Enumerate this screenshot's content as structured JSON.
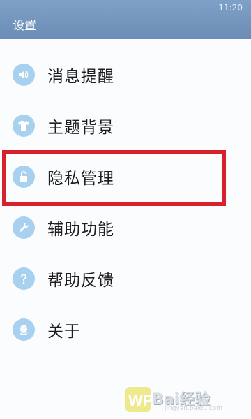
{
  "status_bar": {
    "time": "11:20"
  },
  "header": {
    "title": "设置"
  },
  "settings": {
    "items": [
      {
        "label": "消息提醒",
        "icon": "speaker-icon"
      },
      {
        "label": "主题背景",
        "icon": "tshirt-icon"
      },
      {
        "label": "隐私管理",
        "icon": "lock-icon"
      },
      {
        "label": "辅助功能",
        "icon": "wrench-icon"
      },
      {
        "label": "帮助反馈",
        "icon": "question-icon"
      },
      {
        "label": "关于",
        "icon": "qq-penguin-icon"
      }
    ]
  },
  "annotation": {
    "highlight_color": "#d9212b",
    "highlighted_item": "隐私管理"
  },
  "watermark": {
    "brand": "Bai经验",
    "sub": "jingyan.baidu.com"
  },
  "colors": {
    "header": "#6b8db5",
    "icon_bg": "#a7d1ef"
  }
}
